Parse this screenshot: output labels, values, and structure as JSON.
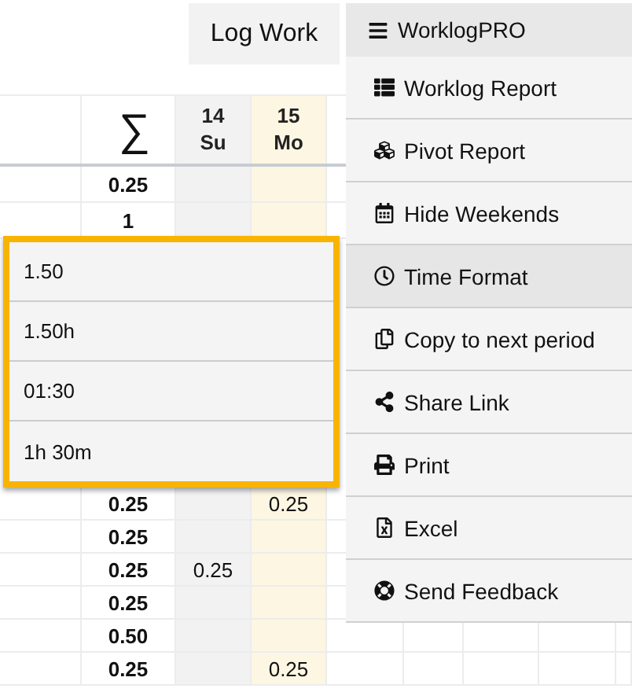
{
  "toolbar": {
    "log_work": "Log Work"
  },
  "table": {
    "sum_header": "∑",
    "days": [
      {
        "number": "14",
        "weekday": "Su",
        "weekend": true,
        "today": false
      },
      {
        "number": "15",
        "weekday": "Mo",
        "weekend": false,
        "today": true
      }
    ],
    "rows_top": [
      {
        "sum": "0.25",
        "cells": [
          "",
          ""
        ]
      },
      {
        "sum": "1",
        "cells": [
          "",
          ""
        ]
      }
    ],
    "rows_bottom": [
      {
        "sum": "0.25",
        "cells": [
          "",
          "0.25"
        ]
      },
      {
        "sum": "0.25",
        "cells": [
          "",
          ""
        ]
      },
      {
        "sum": "0.25",
        "cells": [
          "0.25",
          ""
        ]
      },
      {
        "sum": "0.25",
        "cells": [
          "",
          ""
        ]
      },
      {
        "sum": "0.50",
        "cells": [
          "",
          ""
        ]
      },
      {
        "sum": "0.25",
        "cells": [
          "",
          "0.25"
        ]
      }
    ]
  },
  "time_format_dropdown": {
    "options": [
      "1.50",
      "1.50h",
      "01:30",
      "1h 30m"
    ]
  },
  "menu": {
    "title": "WorklogPRO",
    "items": [
      {
        "label": "Worklog Report",
        "hovered": false
      },
      {
        "label": "Pivot Report",
        "hovered": false
      },
      {
        "label": "Hide Weekends",
        "hovered": false
      },
      {
        "label": "Time Format",
        "hovered": true
      },
      {
        "label": "Copy to next period",
        "hovered": false
      },
      {
        "label": "Share Link",
        "hovered": false
      },
      {
        "label": "Print",
        "hovered": false
      },
      {
        "label": "Excel",
        "hovered": false
      },
      {
        "label": "Send Feedback",
        "hovered": false
      }
    ]
  }
}
